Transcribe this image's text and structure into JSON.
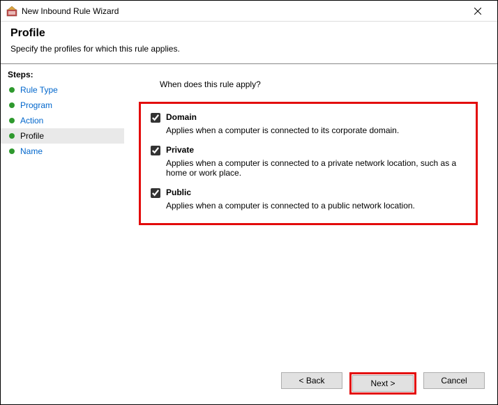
{
  "window": {
    "title": "New Inbound Rule Wizard"
  },
  "header": {
    "title": "Profile",
    "subtitle": "Specify the profiles for which this rule applies."
  },
  "sidebar": {
    "steps_label": "Steps:",
    "items": [
      {
        "label": "Rule Type"
      },
      {
        "label": "Program"
      },
      {
        "label": "Action"
      },
      {
        "label": "Profile"
      },
      {
        "label": "Name"
      }
    ]
  },
  "main": {
    "question": "When does this rule apply?",
    "options": [
      {
        "label": "Domain",
        "description": "Applies when a computer is connected to its corporate domain."
      },
      {
        "label": "Private",
        "description": "Applies when a computer is connected to a private network location, such as a home or work place."
      },
      {
        "label": "Public",
        "description": "Applies when a computer is connected to a public network location."
      }
    ]
  },
  "footer": {
    "back": "< Back",
    "next": "Next >",
    "cancel": "Cancel"
  }
}
